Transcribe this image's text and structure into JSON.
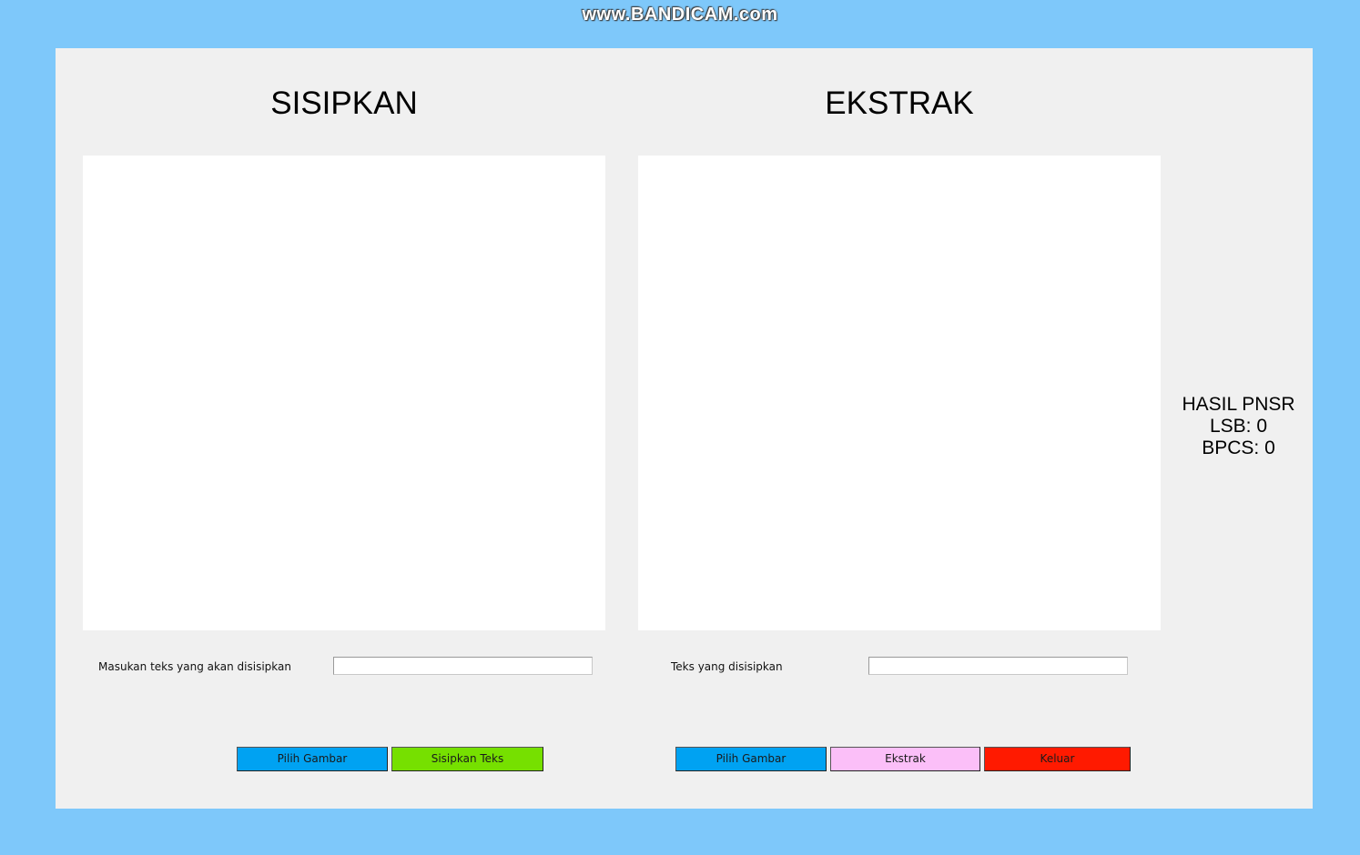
{
  "watermark": "www.BANDICAM.com",
  "insert_section": {
    "title": "SISIPKAN",
    "input_label": "Masukan teks yang akan disisipkan",
    "input_value": "",
    "choose_image_label": "Pilih Gambar",
    "insert_text_label": "Sisipkan Teks"
  },
  "extract_section": {
    "title": "EKSTRAK",
    "output_label": "Teks yang disisipkan",
    "output_value": "",
    "choose_image_label": "Pilih Gambar",
    "extract_label": "Ekstrak",
    "exit_label": "Keluar"
  },
  "psnr": {
    "title": "HASIL PNSR",
    "lsb": "LSB: 0",
    "bpcs": "BPCS: 0"
  },
  "colors": {
    "background": "#7ec8fa",
    "window": "#f0f0f0",
    "choose_image_button": "#00a2f2",
    "insert_text_button": "#76e000",
    "extract_button": "#fbbff8",
    "exit_button": "#ff1a00"
  }
}
